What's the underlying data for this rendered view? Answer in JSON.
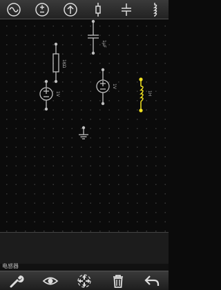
{
  "toolbar": {
    "items": [
      {
        "icon": "ac-source-icon"
      },
      {
        "icon": "dc-source-icon"
      },
      {
        "icon": "arrow-up-icon"
      },
      {
        "icon": "resistor-icon"
      },
      {
        "icon": "capacitor-icon"
      },
      {
        "icon": "inductor-icon"
      }
    ]
  },
  "circuit": {
    "capacitor_label": "1μF",
    "resistor_label": "1KΩ",
    "source_left_label": "1V",
    "source_right_label": "1V",
    "inductor_label": "1H",
    "selected_color": "#f0e020",
    "component_color": "#bfbfbf"
  },
  "status": {
    "selected_component": "电感器"
  },
  "bottombar": {
    "items": [
      {
        "icon": "wrench-icon"
      },
      {
        "icon": "eye-icon"
      },
      {
        "icon": "rotate-icon"
      },
      {
        "icon": "trash-icon"
      },
      {
        "icon": "undo-icon"
      }
    ]
  }
}
